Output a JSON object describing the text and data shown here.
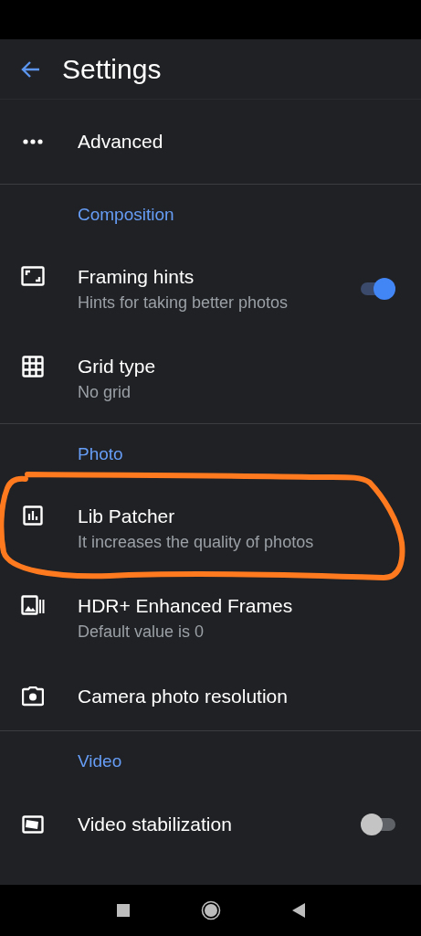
{
  "toolbar": {
    "title": "Settings"
  },
  "list": [
    {
      "kind": "item",
      "title": "Advanced"
    },
    {
      "kind": "divider"
    },
    {
      "kind": "header",
      "title": "Composition"
    },
    {
      "kind": "item",
      "title": "Framing hints",
      "subtitle": "Hints for taking better photos",
      "switch": {
        "on": true
      }
    },
    {
      "kind": "item",
      "title": "Grid type",
      "subtitle": "No grid"
    },
    {
      "kind": "divider"
    },
    {
      "kind": "header",
      "title": "Photo"
    },
    {
      "kind": "item",
      "title": "Lib Patcher",
      "subtitle": "It increases the quality of photos"
    },
    {
      "kind": "item",
      "title": "HDR+ Enhanced Frames",
      "subtitle": "Default value is 0"
    },
    {
      "kind": "item",
      "title": "Camera photo resolution"
    },
    {
      "kind": "divider"
    },
    {
      "kind": "header",
      "title": "Video"
    },
    {
      "kind": "item",
      "title": "Video stabilization",
      "switch": {
        "on": false
      }
    }
  ]
}
